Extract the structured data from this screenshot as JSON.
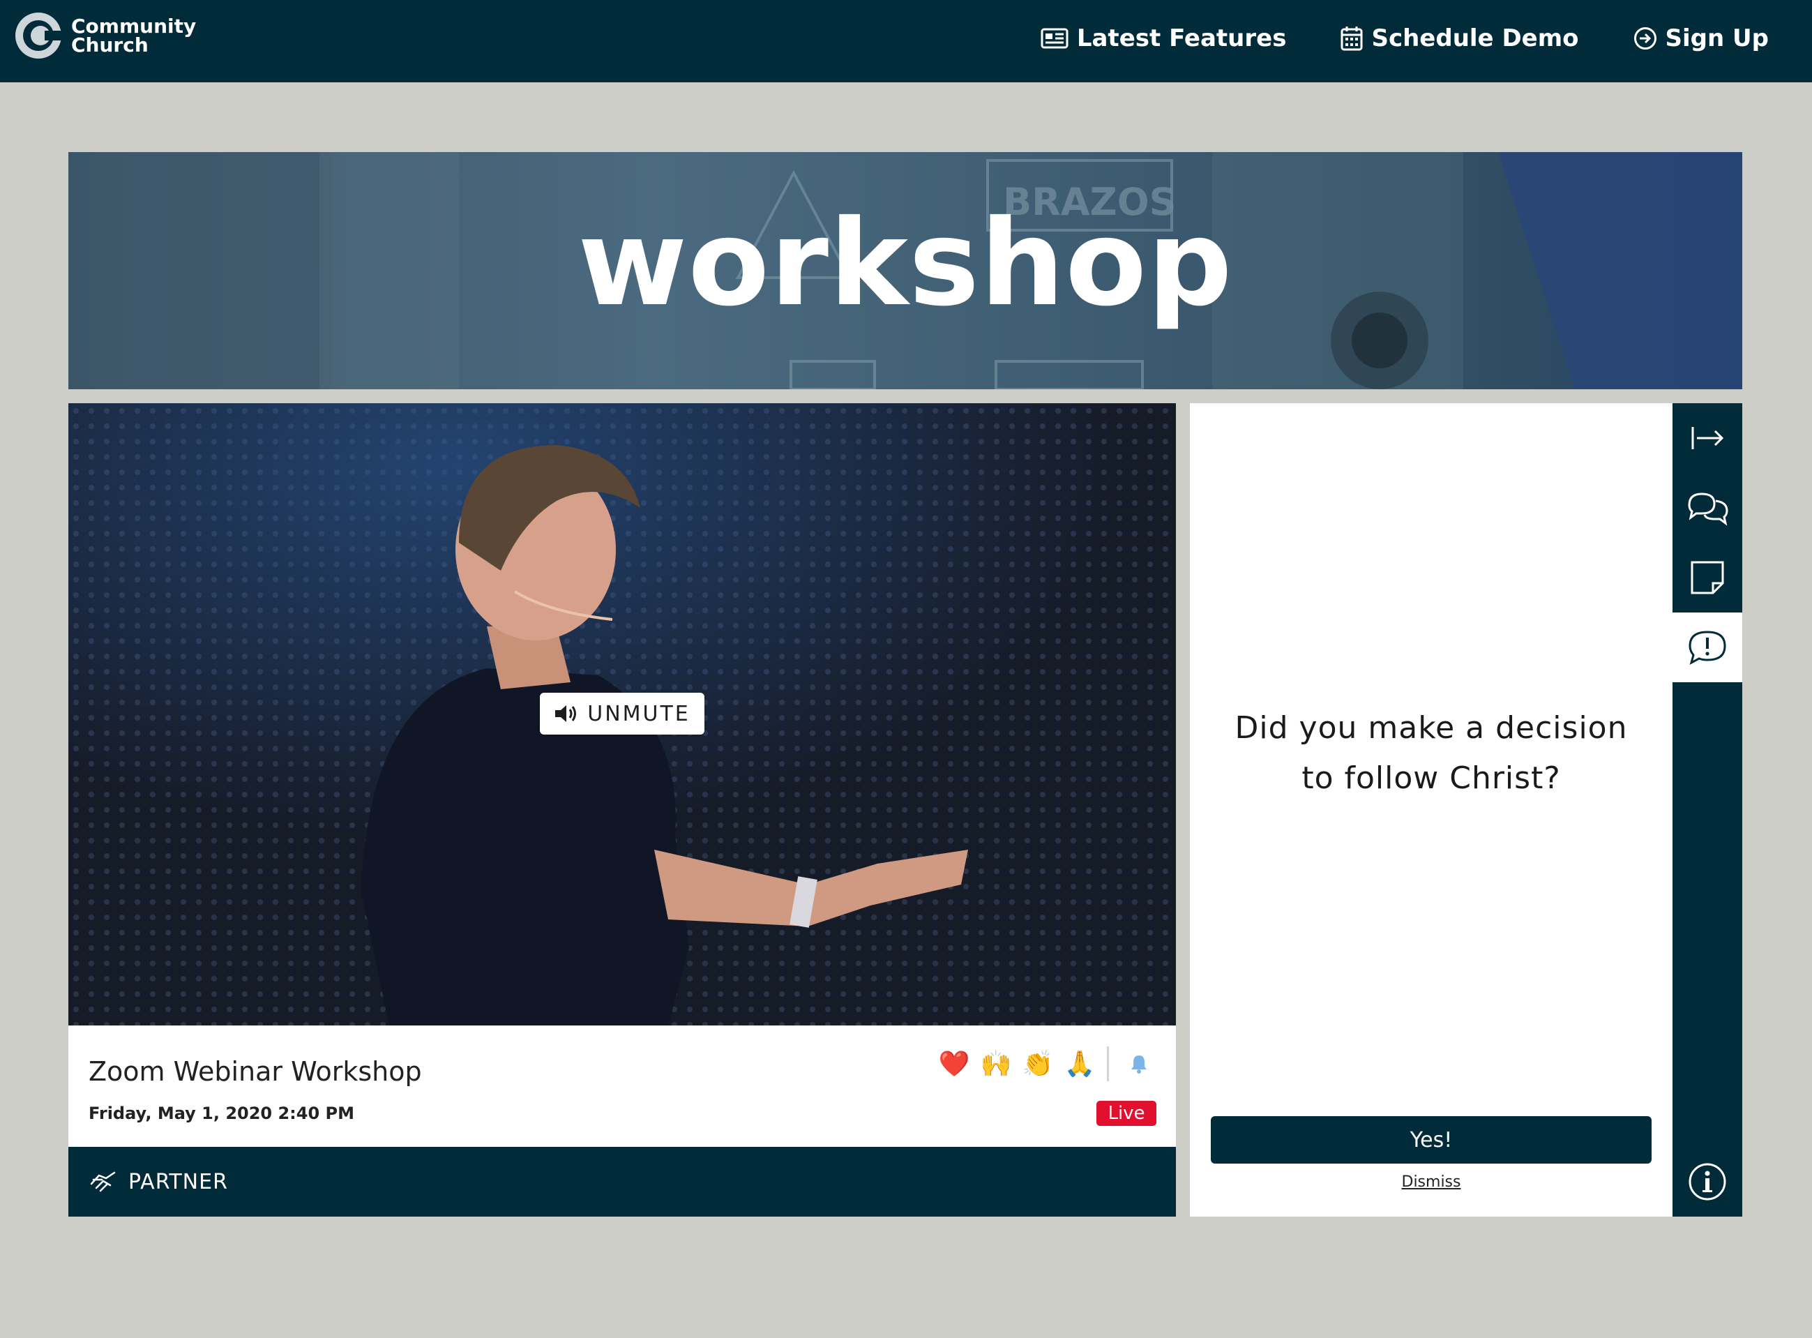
{
  "header": {
    "logo_line1": "Community",
    "logo_line2": "Church",
    "nav": [
      {
        "label": "Latest Features",
        "icon": "newspaper-icon"
      },
      {
        "label": "Schedule Demo",
        "icon": "calendar-icon"
      },
      {
        "label": "Sign Up",
        "icon": "arrow-circle-right-icon"
      }
    ]
  },
  "banner": {
    "title": "workshop"
  },
  "video": {
    "unmute_label": "UNMUTE",
    "title": "Zoom Webinar Workshop",
    "date": "Friday, May 1, 2020 2:40 PM",
    "live_label": "Live",
    "reactions": [
      {
        "name": "heart-reaction",
        "glyph": "❤️"
      },
      {
        "name": "raised-hands-reaction",
        "glyph": "🙌"
      },
      {
        "name": "clapping-reaction",
        "glyph": "👏"
      },
      {
        "name": "praying-hands-reaction",
        "glyph": "🙏"
      }
    ],
    "partner_label": "PARTNER"
  },
  "prompt": {
    "question_line1": "Did you make a decision",
    "question_line2": "to follow Christ?",
    "yes_label": "Yes!",
    "dismiss_label": "Dismiss"
  },
  "colors": {
    "navy": "#022b3a",
    "page_bg": "#cdcec8",
    "live_red": "#e2102f",
    "bell_blue": "#7cb4e8"
  },
  "rail": {
    "buttons": [
      "exit-icon",
      "chat-icon",
      "notes-icon",
      "prompt-icon",
      "info-icon"
    ],
    "active": "prompt-icon"
  }
}
